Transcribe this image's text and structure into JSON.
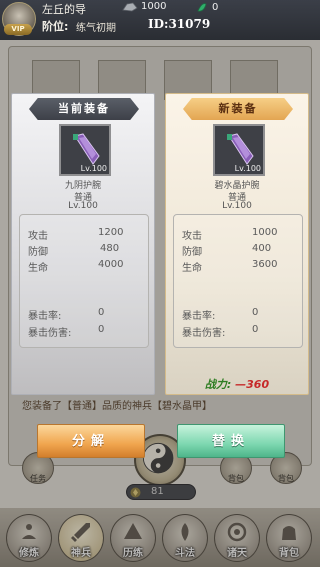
{
  "player": {
    "name": "左丘的导",
    "vip_label": "VIP",
    "rank_label": "阶位:",
    "rank_value": "练气初期",
    "id_label": "ID:31079"
  },
  "currency": {
    "stones": "1000",
    "jade": "0"
  },
  "current_equipment": {
    "header": "当前装备",
    "item_level_badge": "Lv.100",
    "item_name": "九阴护腕",
    "quality": "普通",
    "level": "Lv.100",
    "stats": {
      "attack_label": "攻击",
      "attack_value": "1200",
      "defense_label": "防御",
      "defense_value": "480",
      "hp_label": "生命",
      "hp_value": "4000",
      "crit_rate_label": "暴击率:",
      "crit_rate_value": "0",
      "crit_dmg_label": "暴击伤害:",
      "crit_dmg_value": "0"
    }
  },
  "new_equipment": {
    "header": "新装备",
    "item_level_badge": "Lv.100",
    "item_name": "碧水晶护腕",
    "quality": "普通",
    "level": "Lv.100",
    "stats": {
      "attack_label": "攻击",
      "attack_value": "1000",
      "defense_label": "防御",
      "defense_value": "400",
      "hp_label": "生命",
      "hp_value": "3600",
      "crit_rate_label": "暴击率:",
      "crit_rate_value": "0",
      "crit_dmg_label": "暴击伤害:",
      "crit_dmg_value": "0"
    },
    "power_label": "战力:",
    "power_value": "—360"
  },
  "message": "您装备了【普通】品质的神兵【碧水晶甲】",
  "buttons": {
    "decompose": "分解",
    "replace": "替换"
  },
  "side_buttons": {
    "left": "任务",
    "right1": "背包",
    "right2": "背包"
  },
  "energy": "81",
  "bottom_nav": [
    {
      "label": "修炼",
      "icon": "meditate-icon"
    },
    {
      "label": "神兵",
      "icon": "sword-icon"
    },
    {
      "label": "历练",
      "icon": "training-icon"
    },
    {
      "label": "斗法",
      "icon": "battle-icon"
    },
    {
      "label": "诸天",
      "icon": "realm-icon"
    },
    {
      "label": "背包",
      "icon": "bag-icon"
    }
  ],
  "colors": {
    "power_label": "#2e7d22",
    "power_value": "#c62828",
    "decompose_button": "#f0a54e",
    "replace_button": "#7dd7b0"
  }
}
